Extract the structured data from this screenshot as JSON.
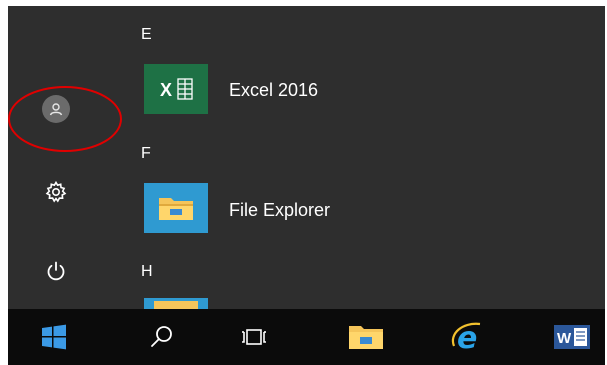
{
  "start_menu": {
    "groups": [
      {
        "letter": "E",
        "apps": [
          {
            "name": "Excel 2016",
            "icon": "excel-icon",
            "tile_color": "#1e7145"
          }
        ]
      },
      {
        "letter": "F",
        "apps": [
          {
            "name": "File Explorer",
            "icon": "file-explorer-icon",
            "tile_color": "#2f9ad1"
          }
        ]
      },
      {
        "letter": "H",
        "apps": []
      }
    ],
    "rail": [
      {
        "name": "account",
        "icon": "user-avatar-icon"
      },
      {
        "name": "settings",
        "icon": "gear-icon"
      },
      {
        "name": "power",
        "icon": "power-icon"
      }
    ],
    "annotation_color": "#e00000"
  },
  "excel_glyph": "X",
  "taskbar": {
    "items": [
      {
        "name": "start",
        "icon": "windows-logo-icon"
      },
      {
        "name": "search",
        "icon": "search-icon"
      },
      {
        "name": "task-view",
        "icon": "task-view-icon"
      },
      {
        "name": "file-explorer",
        "icon": "folder-icon"
      },
      {
        "name": "internet-explorer",
        "icon": "internet-explorer-icon"
      },
      {
        "name": "word",
        "icon": "word-icon"
      }
    ],
    "word_glyph": "W"
  },
  "colors": {
    "menu_bg": "#2e2e2e",
    "taskbar_bg": "#0b0b0b",
    "start_accent": "#3b9ae6",
    "excel_green": "#1e7145",
    "explorer_blue": "#2f9ad1"
  }
}
